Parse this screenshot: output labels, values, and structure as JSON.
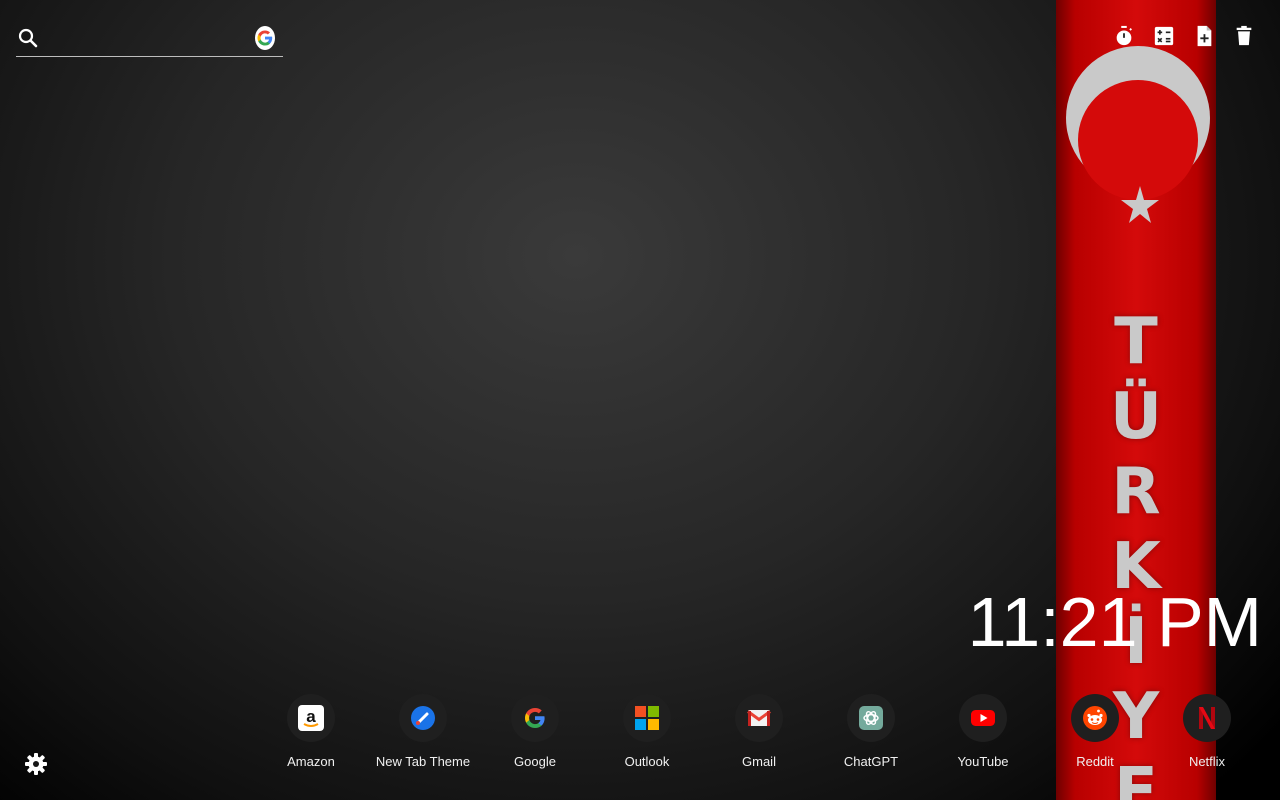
{
  "search": {
    "value": "",
    "placeholder": "",
    "search_icon": "search-icon",
    "engine_icon": "google-g-icon"
  },
  "toolbar": {
    "items": [
      {
        "icon": "stopwatch-icon"
      },
      {
        "icon": "calculator-icon"
      },
      {
        "icon": "add-note-icon"
      },
      {
        "icon": "trash-icon"
      }
    ]
  },
  "wallpaper": {
    "letters": [
      "T",
      "Ü",
      "R",
      "K",
      "İ",
      "Y",
      "E"
    ],
    "colors": {
      "flag_red": "#d40a0a",
      "emblem": "#c9c9c9"
    }
  },
  "clock": {
    "time": "11:21 PM"
  },
  "shortcuts": [
    {
      "label": "Amazon",
      "icon": "amazon-icon"
    },
    {
      "label": "New Tab Theme",
      "icon": "new-tab-theme-icon"
    },
    {
      "label": "Google",
      "icon": "google-icon"
    },
    {
      "label": "Outlook",
      "icon": "microsoft-icon"
    },
    {
      "label": "Gmail",
      "icon": "gmail-icon"
    },
    {
      "label": "ChatGPT",
      "icon": "chatgpt-icon"
    },
    {
      "label": "YouTube",
      "icon": "youtube-icon"
    },
    {
      "label": "Reddit",
      "icon": "reddit-icon"
    },
    {
      "label": "Netflix",
      "icon": "netflix-icon"
    }
  ],
  "settings": {
    "icon": "gear-icon"
  }
}
